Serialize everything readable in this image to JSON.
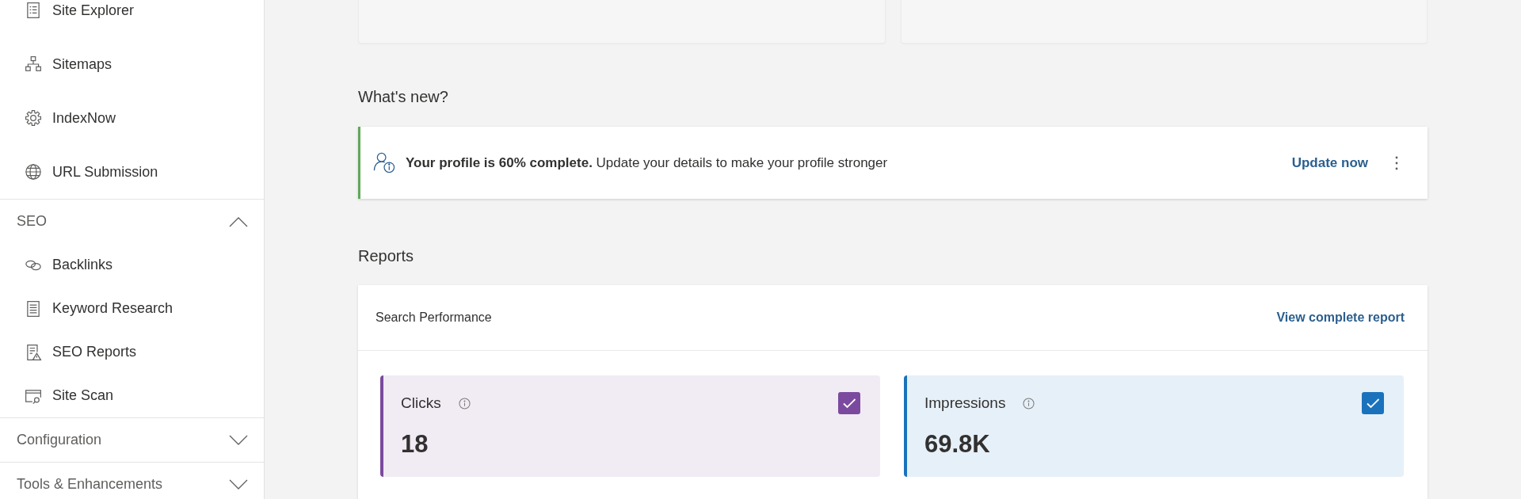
{
  "sidebar": {
    "items": [
      {
        "label": "Site Explorer"
      },
      {
        "label": "Sitemaps"
      },
      {
        "label": "IndexNow"
      },
      {
        "label": "URL Submission"
      }
    ],
    "sections": [
      {
        "title": "SEO",
        "expanded": true,
        "items": [
          {
            "label": "Backlinks"
          },
          {
            "label": "Keyword Research"
          },
          {
            "label": "SEO Reports"
          },
          {
            "label": "Site Scan"
          }
        ]
      },
      {
        "title": "Configuration",
        "expanded": false
      },
      {
        "title": "Tools & Enhancements",
        "expanded": false
      }
    ]
  },
  "whats_new": {
    "title": "What's new?",
    "notice": {
      "message": "**Your profile is 60% complete.** Update your details to make your profile stronger",
      "action": "Update now"
    }
  },
  "reports": {
    "title": "Reports",
    "card": {
      "title": "Search Performance",
      "link": "View complete report",
      "metrics": [
        {
          "label": "Clicks",
          "value": "18",
          "checked": true,
          "color": "#7b4a9e"
        },
        {
          "label": "Impressions",
          "value": "69.8K",
          "checked": true,
          "color": "#1a72bd"
        }
      ]
    }
  }
}
